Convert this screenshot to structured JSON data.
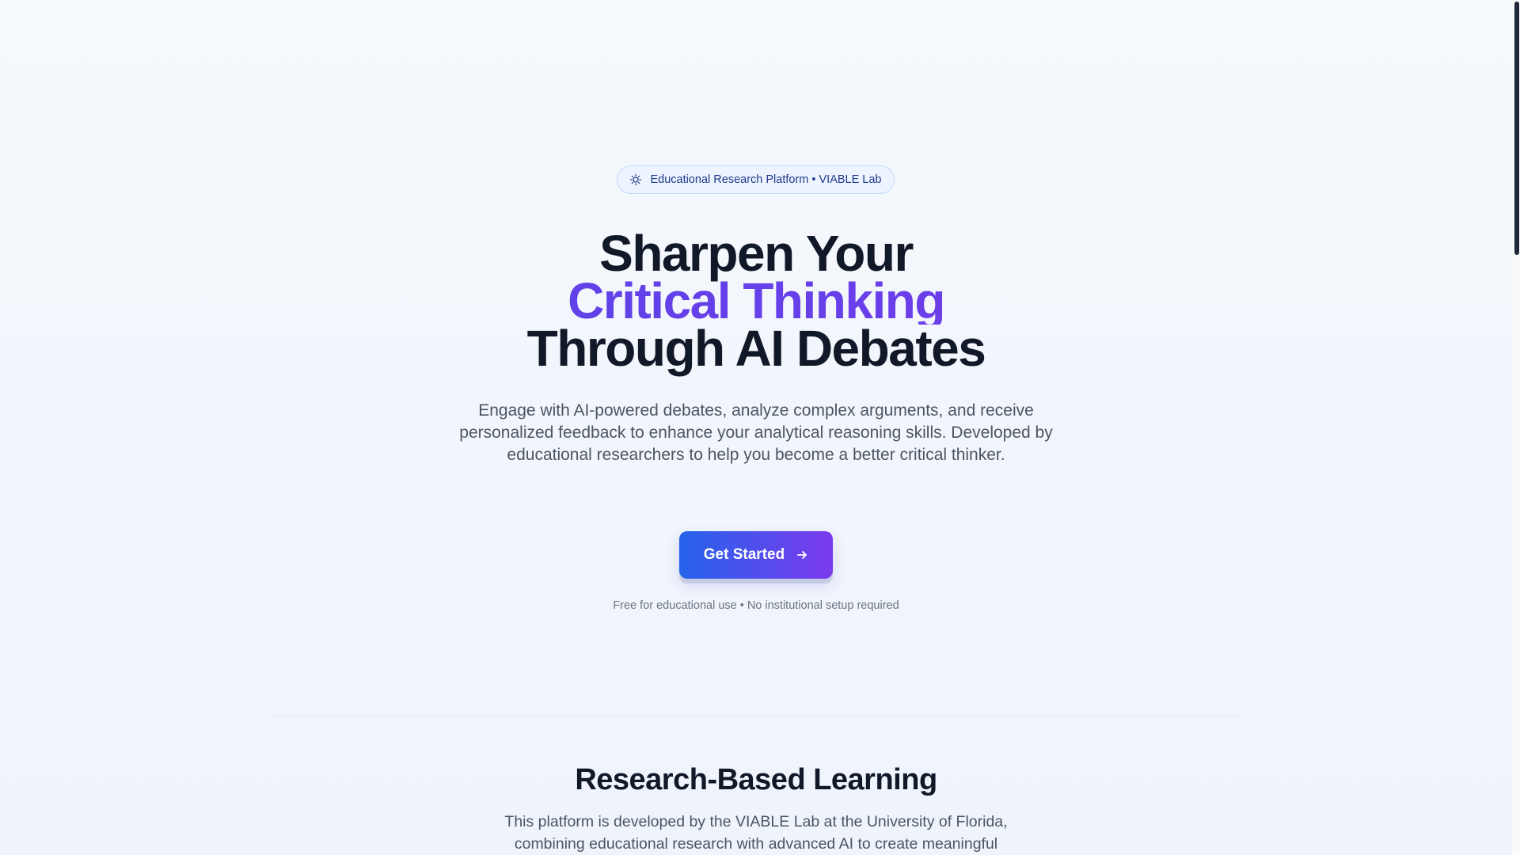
{
  "hero": {
    "badge": {
      "icon": "lightbulb-icon",
      "text": "Educational Research Platform • VIABLE Lab"
    },
    "headline": {
      "line1": "Sharpen Your",
      "line2": "Critical Thinking",
      "line3": "Through AI Debates"
    },
    "subtitle": "Engage with AI-powered debates, analyze complex arguments, and receive personalized feedback to enhance your analytical reasoning skills. Developed by educational researchers to help you become a better critical thinker.",
    "cta": {
      "label": "Get Started",
      "icon": "arrow-right-icon",
      "note": "Free for educational use • No institutional setup required"
    }
  },
  "research_section": {
    "title": "Research-Based Learning",
    "text": "This platform is developed by the VIABLE Lab at the University of Florida, combining educational research with advanced AI to create meaningful"
  },
  "colors": {
    "accent_start": "#2563eb",
    "accent_end": "#7c3aed",
    "headline_accent_start": "#4f46e5",
    "text_dark": "#111827",
    "text_muted": "#4b5563"
  }
}
